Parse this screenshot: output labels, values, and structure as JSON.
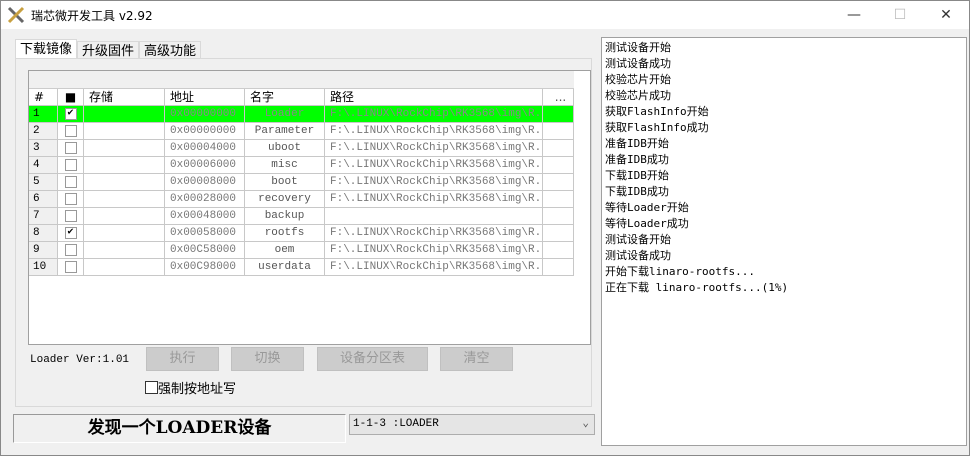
{
  "window": {
    "title": "瑞芯微开发工具 v2.92",
    "minimize": "—",
    "maximize": "☐",
    "close": "✕"
  },
  "tabs": [
    {
      "label": "下载镜像"
    },
    {
      "label": "升级固件"
    },
    {
      "label": "高级功能"
    }
  ],
  "table": {
    "headers": [
      "#",
      "■",
      "存储",
      "地址",
      "名字",
      "路径",
      "..."
    ],
    "rows": [
      {
        "n": "1",
        "checked": true,
        "storage": "",
        "addr": "0x00000000",
        "name": "Loader",
        "path": "F:\\.LINUX\\RockChip\\RK3568\\img\\R..."
      },
      {
        "n": "2",
        "checked": false,
        "storage": "",
        "addr": "0x00000000",
        "name": "Parameter",
        "path": "F:\\.LINUX\\RockChip\\RK3568\\img\\R..."
      },
      {
        "n": "3",
        "checked": false,
        "storage": "",
        "addr": "0x00004000",
        "name": "uboot",
        "path": "F:\\.LINUX\\RockChip\\RK3568\\img\\R..."
      },
      {
        "n": "4",
        "checked": false,
        "storage": "",
        "addr": "0x00006000",
        "name": "misc",
        "path": "F:\\.LINUX\\RockChip\\RK3568\\img\\R..."
      },
      {
        "n": "5",
        "checked": false,
        "storage": "",
        "addr": "0x00008000",
        "name": "boot",
        "path": "F:\\.LINUX\\RockChip\\RK3568\\img\\R..."
      },
      {
        "n": "6",
        "checked": false,
        "storage": "",
        "addr": "0x00028000",
        "name": "recovery",
        "path": "F:\\.LINUX\\RockChip\\RK3568\\img\\R..."
      },
      {
        "n": "7",
        "checked": false,
        "storage": "",
        "addr": "0x00048000",
        "name": "backup",
        "path": ""
      },
      {
        "n": "8",
        "checked": true,
        "storage": "",
        "addr": "0x00058000",
        "name": "rootfs",
        "path": "F:\\.LINUX\\RockChip\\RK3568\\img\\R..."
      },
      {
        "n": "9",
        "checked": false,
        "storage": "",
        "addr": "0x00C58000",
        "name": "oem",
        "path": "F:\\.LINUX\\RockChip\\RK3568\\img\\R..."
      },
      {
        "n": "10",
        "checked": false,
        "storage": "",
        "addr": "0x00C98000",
        "name": "userdata",
        "path": "F:\\.LINUX\\RockChip\\RK3568\\img\\R..."
      }
    ],
    "highlight_color": "#00ff00"
  },
  "loader_ver": "Loader Ver:1.01",
  "buttons": {
    "run": "执行",
    "switch": "切换",
    "partition": "设备分区表",
    "clear": "清空"
  },
  "force_addr": {
    "label": "强制按地址写",
    "checked": false
  },
  "status": "发现一个LOADER设备",
  "device_select": {
    "value": "1-1-3 :LOADER"
  },
  "log": [
    "测试设备开始",
    "测试设备成功",
    "校验芯片开始",
    "校验芯片成功",
    "获取FlashInfo开始",
    "获取FlashInfo成功",
    "准备IDB开始",
    "准备IDB成功",
    "下载IDB开始",
    "下载IDB成功",
    "等待Loader开始",
    "等待Loader成功",
    "测试设备开始",
    "测试设备成功",
    "开始下载linaro-rootfs...",
    "正在下载 linaro-rootfs...(1%)"
  ]
}
